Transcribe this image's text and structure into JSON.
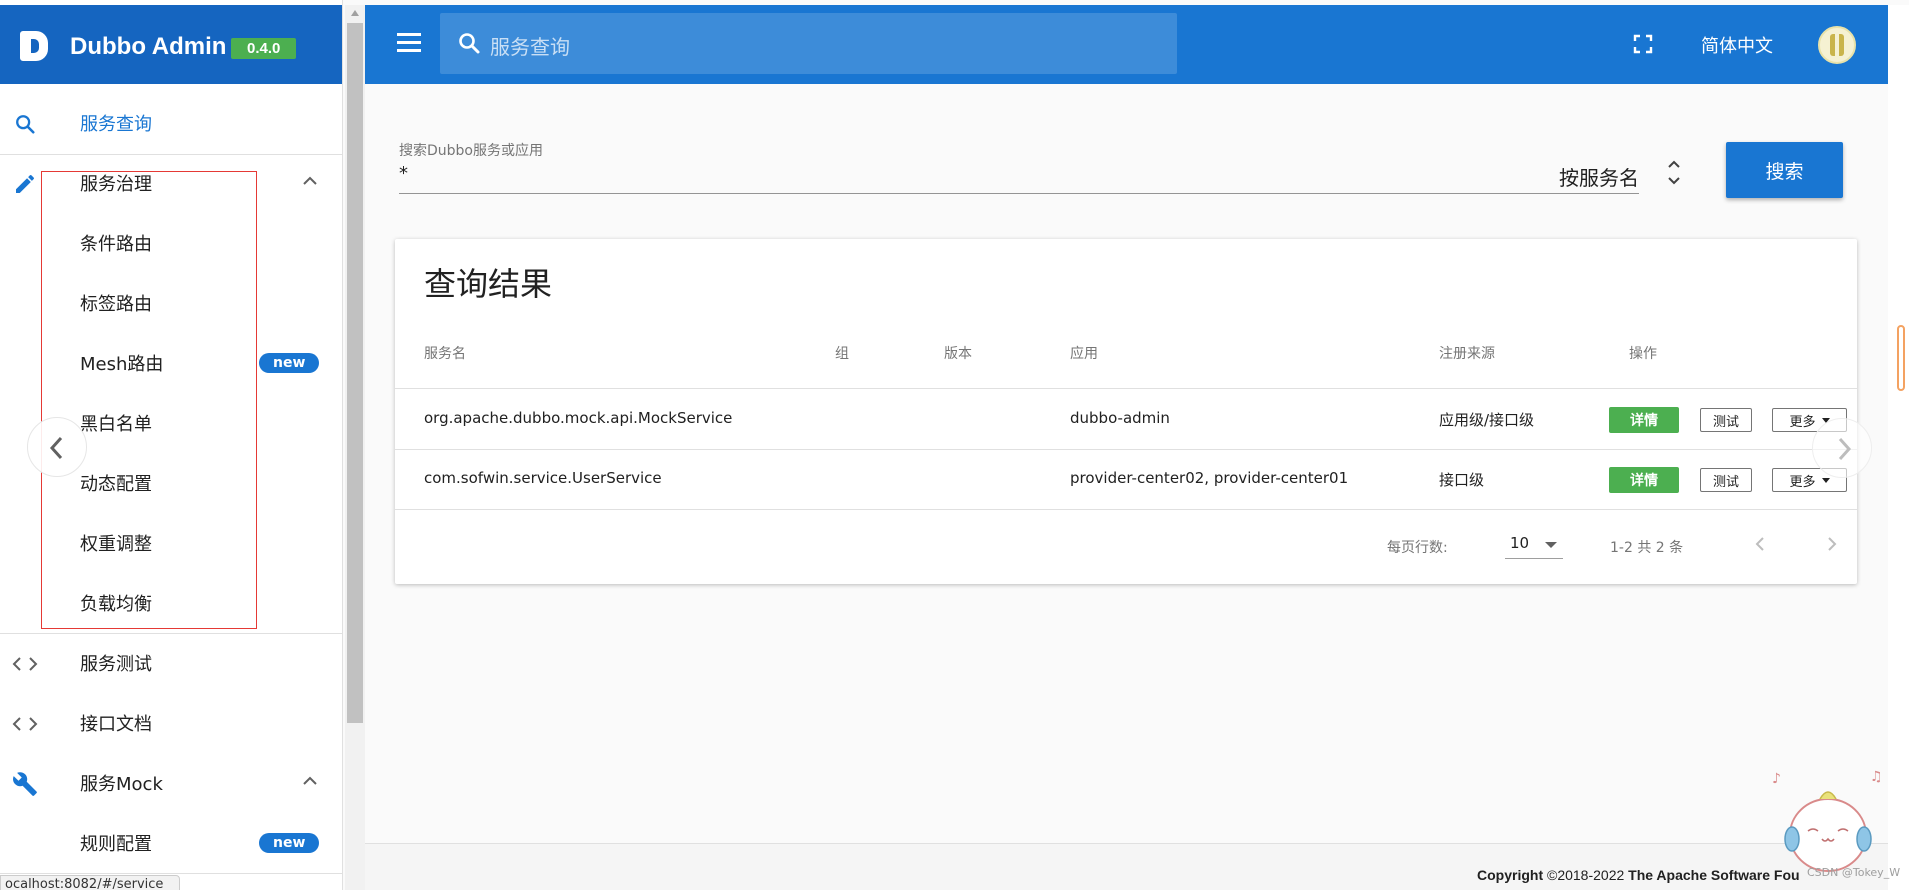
{
  "app": {
    "name": "Dubbo Admin",
    "version": "0.4.0",
    "brand_color": "#1565c0",
    "topbar_color": "#1976d2"
  },
  "topbar": {
    "menu_icon": "menu-icon",
    "search_placeholder": "服务查询",
    "fullscreen_icon": "fullscreen-icon",
    "language": "简体中文",
    "avatar_icon": "avatar"
  },
  "sidebar": {
    "items": [
      {
        "id": "service-search",
        "label": "服务查询",
        "icon": "search-icon",
        "active": true
      },
      {
        "id": "service-governance",
        "label": "服务治理",
        "icon": "pencil-icon",
        "expanded": true
      },
      {
        "id": "condition-route",
        "label": "条件路由"
      },
      {
        "id": "tag-route",
        "label": "标签路由"
      },
      {
        "id": "mesh-route",
        "label": "Mesh路由",
        "badge": "new"
      },
      {
        "id": "access-control",
        "label": "黑白名单"
      },
      {
        "id": "dynamic-config",
        "label": "动态配置"
      },
      {
        "id": "weight-adjust",
        "label": "权重调整"
      },
      {
        "id": "load-balance",
        "label": "负载均衡"
      },
      {
        "id": "service-test",
        "label": "服务测试",
        "icon": "code-icon"
      },
      {
        "id": "api-docs",
        "label": "接口文档",
        "icon": "code-icon"
      },
      {
        "id": "service-mock",
        "label": "服务Mock",
        "icon": "wrench-icon",
        "expanded": true
      },
      {
        "id": "rule-config",
        "label": "规则配置",
        "badge": "new"
      }
    ],
    "url_tip": "ocalhost:8082/#/service"
  },
  "search": {
    "label": "搜索Dubbo服务或应用",
    "value": "*",
    "type": "按服务名",
    "button": "搜索"
  },
  "results": {
    "title": "查询结果",
    "columns": [
      "服务名",
      "组",
      "版本",
      "应用",
      "注册来源",
      "操作"
    ],
    "rows": [
      {
        "service": "org.apache.dubbo.mock.api.MockService",
        "group": "",
        "version": "",
        "application": "dubbo-admin",
        "registry_source": "应用级/接口级",
        "actions": [
          "详情",
          "测试",
          "更多"
        ]
      },
      {
        "service": "com.sofwin.service.UserService",
        "group": "",
        "version": "",
        "application": "provider-center02, provider-center01",
        "registry_source": "接口级",
        "actions": [
          "详情",
          "测试",
          "更多"
        ]
      }
    ],
    "pagination": {
      "rows_per_page_label": "每页行数:",
      "rows_per_page": "10",
      "range": "1-2 共 2 条"
    }
  },
  "footer": {
    "copyright_word": "Copyright",
    "years": "©2018-2022",
    "org": "The Apache Software Fou"
  },
  "watermark": "CSDN @Tokey_W",
  "colors": {
    "detail_button": "#4caf50",
    "badge": "#1976d2",
    "highlight_box": "#e53935"
  }
}
